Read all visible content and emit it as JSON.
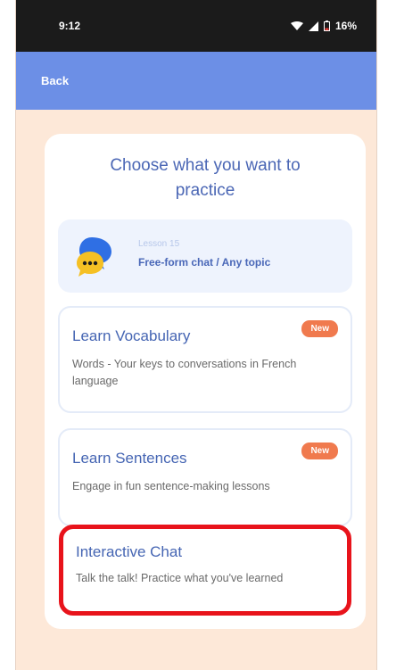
{
  "status_bar": {
    "time": "9:12",
    "icons": "wifi-icon signal-icon battery-icon",
    "battery": "16%"
  },
  "app_bar": {
    "back_label": "Back",
    "color": "#6c8fe6"
  },
  "card": {
    "title": "Choose what you want to practice",
    "lesson": {
      "number": "Lesson 15",
      "topic": "Free-form chat / Any topic"
    },
    "options": [
      {
        "title": "Learn Vocabulary",
        "description": "Words - Your keys to conversations in French language",
        "badge": "New"
      },
      {
        "title": "Learn Sentences",
        "description": "Engage in fun sentence-making lessons",
        "badge": "New"
      },
      {
        "title": "Interactive Chat",
        "description": "Talk the talk! Practice what you've learned",
        "highlight_color": "#e8131b"
      }
    ]
  },
  "colors": {
    "background": "#fde8d8",
    "accent": "#4b67b5",
    "badge": "#f07a4e"
  }
}
